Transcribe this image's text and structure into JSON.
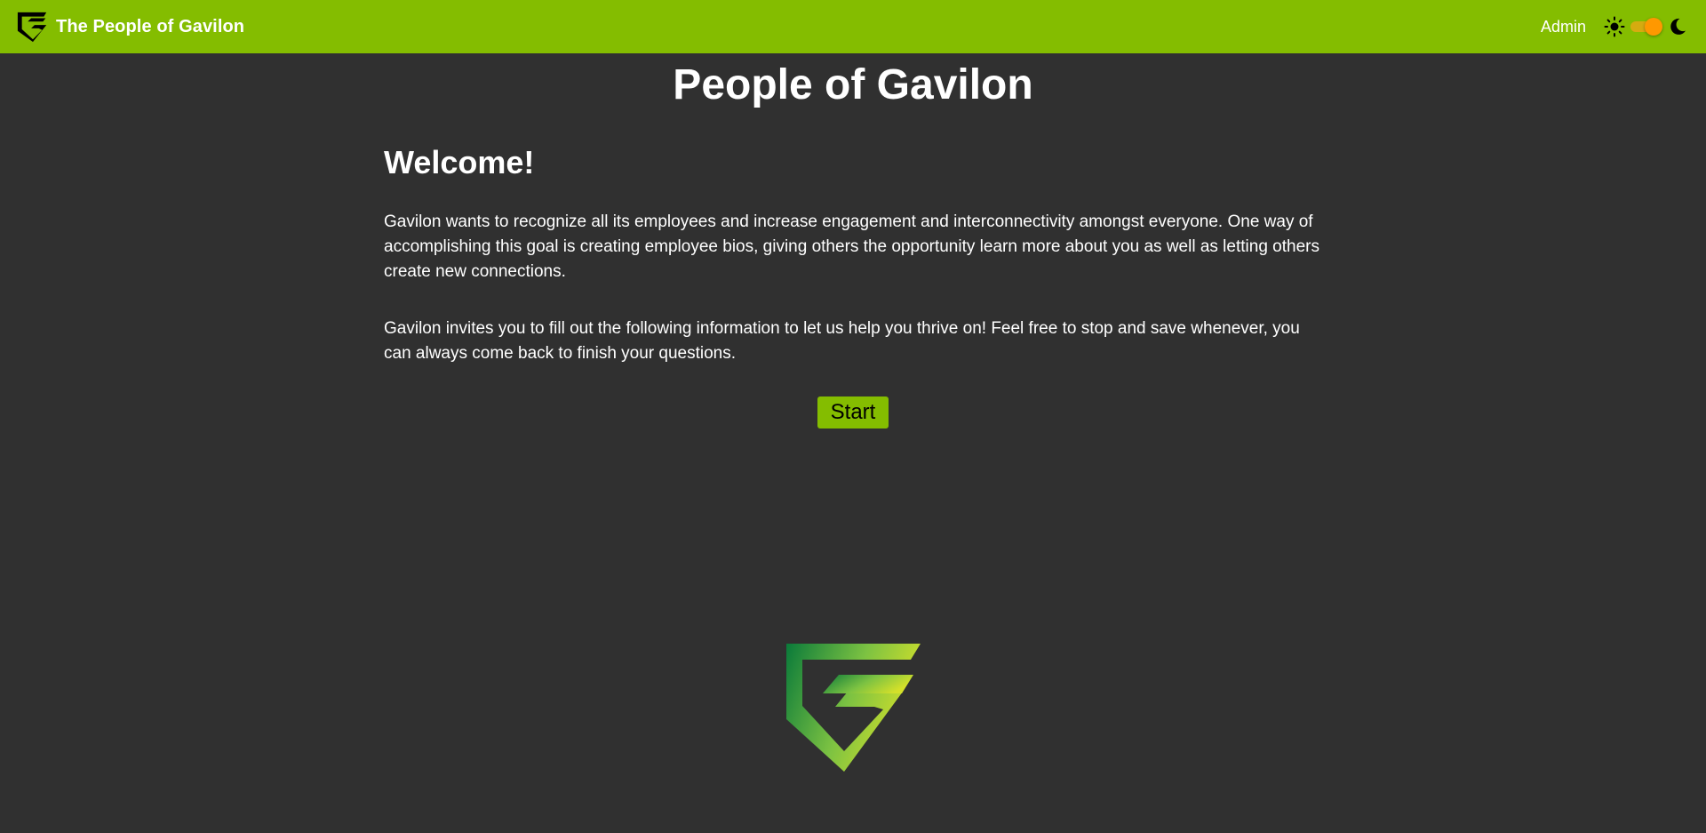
{
  "app": {
    "brand_title": "The People of Gavilon",
    "logo_icon": "gavilon-shield-logo-icon"
  },
  "header": {
    "admin_label": "Admin",
    "theme_toggle": {
      "light_icon": "sun-icon",
      "dark_icon": "moon-icon",
      "state": "on"
    }
  },
  "main": {
    "page_title": "People of Gavilon",
    "welcome_heading": "Welcome!",
    "paragraph_1": "Gavilon wants to recognize all its employees and increase engagement and interconnectivity amongst everyone. One way of accomplishing this goal is creating employee bios, giving others the opportunity learn more about you as well as letting others create new connections.",
    "paragraph_2": "Gavilon invites you to fill out the following information to let us help you thrive on! Feel free to stop and save whenever, you can always come back to finish your questions.",
    "start_label": "Start"
  },
  "colors": {
    "header_bg": "#84bd00",
    "page_bg": "#303030",
    "text": "#ffffff",
    "button_bg": "#84bd00",
    "toggle_accent": "#ff9800",
    "logo_gradient_start": "#0a7a3a",
    "logo_gradient_end": "#d4e02a"
  }
}
